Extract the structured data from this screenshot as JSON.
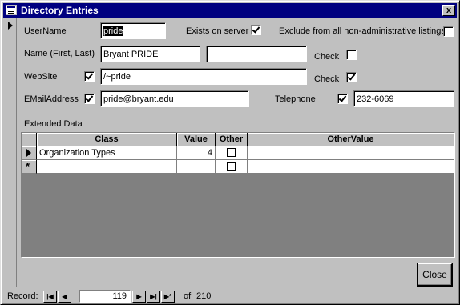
{
  "window": {
    "title": "Directory Entries",
    "close_glyph": "x"
  },
  "form": {
    "username_label": "UserName",
    "username_value": "pride",
    "exists_label": "Exists on server",
    "exists_checked": true,
    "exclude_label": "Exclude from all non-administrative listings",
    "exclude_checked": false,
    "name_label": "Name (First, Last)",
    "name_first": "Bryant PRIDE",
    "name_last": "",
    "name_check_label": "Check",
    "name_check_checked": false,
    "website_label": "WebSite",
    "website_flag_checked": true,
    "website_value": "/~pride",
    "website_check_label": "Check",
    "website_check_checked": true,
    "email_label": "EMailAddress",
    "email_flag_checked": true,
    "email_value": "pride@bryant.edu",
    "telephone_label": "Telephone",
    "telephone_flag_checked": true,
    "telephone_value": "232-6069",
    "extended_label": "Extended Data"
  },
  "grid": {
    "columns": [
      "Class",
      "Value",
      "Other",
      "OtherValue"
    ],
    "rows": [
      {
        "class": "Organization Types",
        "value": "4",
        "other": false,
        "other_value": ""
      }
    ],
    "new_row_glyph": "*"
  },
  "buttons": {
    "close_label": "Close"
  },
  "nav": {
    "record_label": "Record:",
    "current": "119",
    "of_label": "of",
    "total": "210",
    "first_glyph": "|◀",
    "prev_glyph": "◀",
    "next_glyph": "▶",
    "last_glyph": "▶|",
    "new_glyph": "▶*"
  }
}
